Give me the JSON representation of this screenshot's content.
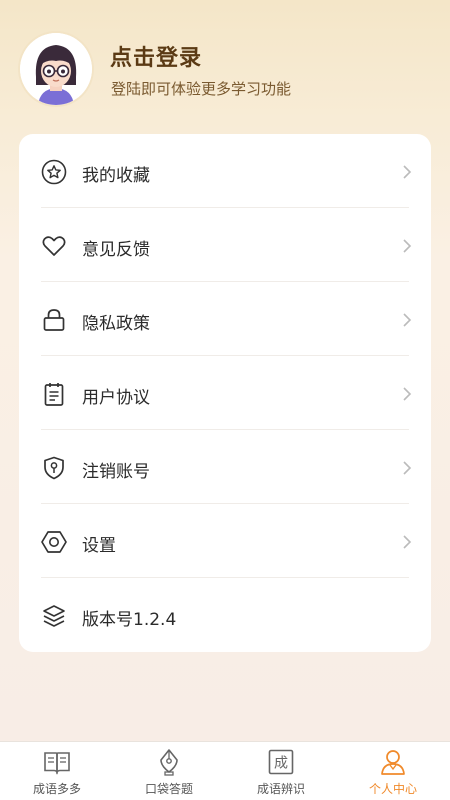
{
  "profile": {
    "title": "点击登录",
    "subtitle": "登陆即可体验更多学习功能",
    "avatar_icon": "girl-avatar-icon"
  },
  "menu": [
    {
      "label": "我的收藏",
      "icon": "star-icon",
      "chevron": true
    },
    {
      "label": "意见反馈",
      "icon": "heart-icon",
      "chevron": true
    },
    {
      "label": "隐私政策",
      "icon": "lock-icon",
      "chevron": true
    },
    {
      "label": "用户协议",
      "icon": "document-icon",
      "chevron": true
    },
    {
      "label": "注销账号",
      "icon": "shield-key-icon",
      "chevron": true
    },
    {
      "label": "设置",
      "icon": "hexagon-settings-icon",
      "chevron": true
    },
    {
      "label": "版本号1.2.4",
      "icon": "layers-icon",
      "chevron": false
    }
  ],
  "tabs": [
    {
      "label": "成语多多",
      "icon": "book-icon",
      "active": false
    },
    {
      "label": "口袋答题",
      "icon": "pen-nib-icon",
      "active": false
    },
    {
      "label": "成语辨识",
      "icon": "cheng-char-icon",
      "glyph": "成",
      "active": false
    },
    {
      "label": "个人中心",
      "icon": "person-icon",
      "active": true
    }
  ],
  "colors": {
    "accent": "#f08a2b",
    "title": "#5b3a14",
    "text": "#2b2b2b"
  }
}
